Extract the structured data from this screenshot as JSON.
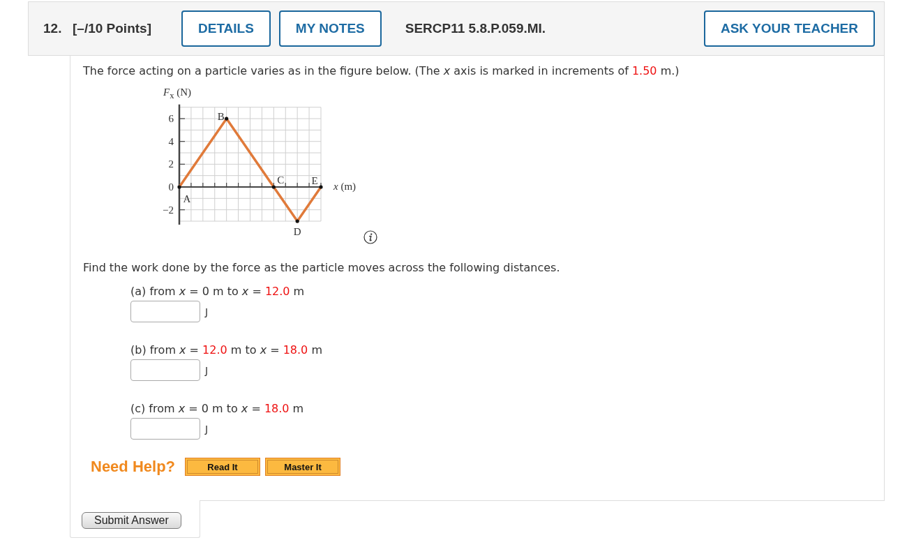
{
  "question": {
    "number": "12.",
    "points": "[–/10 Points]",
    "buttons": [
      "DETAILS",
      "MY NOTES"
    ],
    "code": "SERCP11 5.8.P.059.MI.",
    "ask_button": "ASK YOUR TEACHER"
  },
  "intro": [
    {
      "text": "The force acting on a particle varies as in the figure below. (The *x* axis is marked in increments of ",
      "highlight": false
    },
    {
      "text": "1.50",
      "highlight": true
    },
    {
      "text": " m.)",
      "highlight": false
    }
  ],
  "figure": {
    "chart_data": {
      "type": "line",
      "ylabel": "*F*$_{x}$ (N)",
      "xlabel": "*x* (m)",
      "categories": [
        null,
        null,
        null,
        null,
        null,
        null,
        null,
        null,
        null,
        null,
        null,
        null,
        null
      ],
      "values": [
        0,
        1.5,
        3,
        4.5,
        6,
        4.5,
        3,
        1.5,
        0,
        -1.5,
        -3,
        -1.5,
        0
      ],
      "color": "#e07a3a",
      "ylim": [
        -3,
        7
      ],
      "yticks": [
        {
          "value": -2,
          "label": "−2"
        },
        {
          "value": 0,
          "label": "0"
        },
        {
          "value": 2,
          "label": "2"
        },
        {
          "value": 4,
          "label": "4"
        },
        {
          "value": 6,
          "label": "6"
        }
      ],
      "tick_labels": "y",
      "grid": true,
      "annotations": [
        "A",
        "B",
        "C",
        "D",
        "E"
      ]
    }
  },
  "prompt": "Find the work done by the force as the particle moves across the following distances.",
  "parts": [
    {
      "label": [
        {
          "text": "(a) from *x* = 0 m to *x* = ",
          "highlight": false
        },
        {
          "text": "12.0",
          "highlight": true
        },
        {
          "text": " m",
          "highlight": false
        }
      ],
      "unit": "J"
    },
    {
      "label": [
        {
          "text": "(b) from *x* = ",
          "highlight": false
        },
        {
          "text": "12.0",
          "highlight": true
        },
        {
          "text": " m to *x* = ",
          "highlight": false
        },
        {
          "text": "18.0",
          "highlight": true
        },
        {
          "text": " m",
          "highlight": false
        }
      ],
      "unit": "J"
    },
    {
      "label": [
        {
          "text": "(c) from *x* = 0 m to *x* = ",
          "highlight": false
        },
        {
          "text": "18.0",
          "highlight": true
        },
        {
          "text": " m",
          "highlight": false
        }
      ],
      "unit": "J"
    }
  ],
  "help": {
    "title": "Need Help?",
    "buttons": [
      "Read It",
      "Master It"
    ]
  },
  "submit": "Submit Answer"
}
